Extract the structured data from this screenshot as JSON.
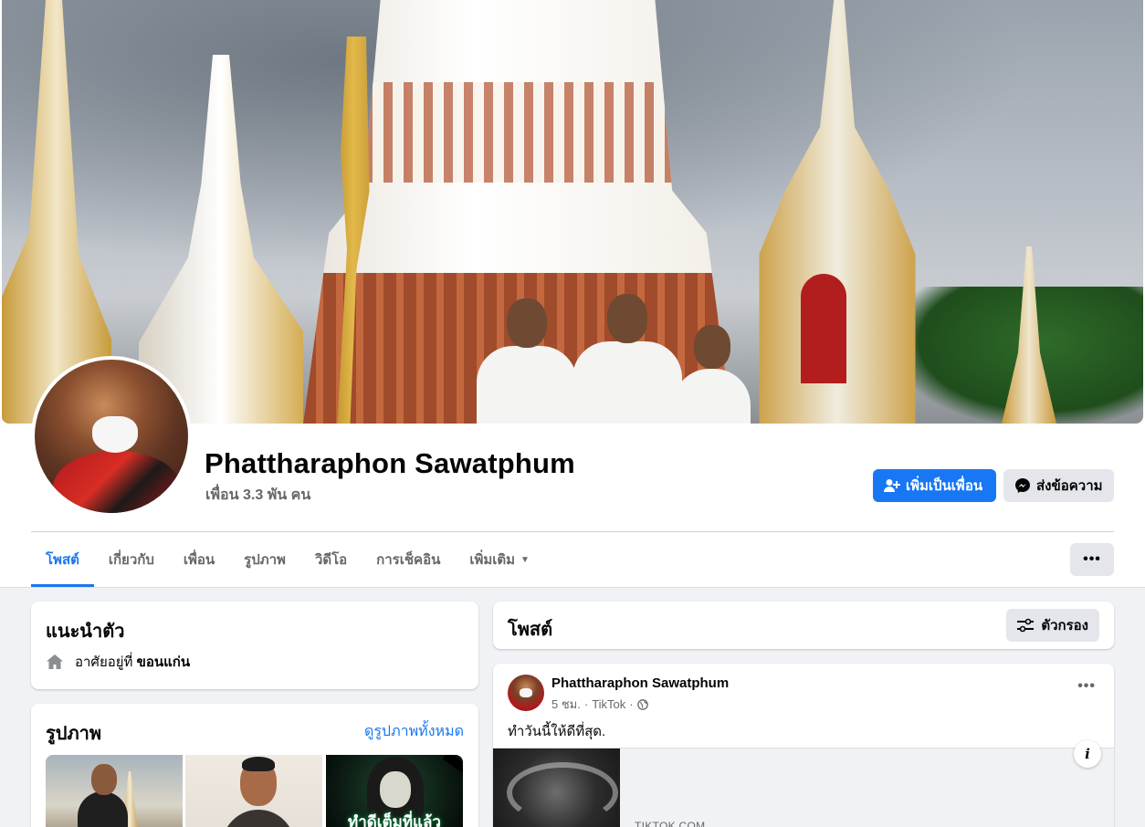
{
  "profile": {
    "name": "Phattharaphon Sawatphum",
    "friends": "เพื่อน 3.3 พัน คน"
  },
  "actions": {
    "add_friend": "เพิ่มเป็นเพื่อน",
    "message": "ส่งข้อความ"
  },
  "tabs": [
    {
      "label": "โพสต์",
      "active": true
    },
    {
      "label": "เกี่ยวกับ"
    },
    {
      "label": "เพื่อน"
    },
    {
      "label": "รูปภาพ"
    },
    {
      "label": "วิดีโอ"
    },
    {
      "label": "การเช็คอิน"
    },
    {
      "label": "เพิ่มเติม"
    }
  ],
  "more_button": "•••",
  "intro": {
    "title": "แนะนำตัว",
    "lives_prefix": "อาศัยอยู่ที่",
    "lives_place": "ขอนแก่น"
  },
  "photos": {
    "title": "รูปภาพ",
    "see_all": "ดูรูปภาพทั้งหมด",
    "caption_3": "ทำดีเต็มที่แล้ว"
  },
  "posts_header": {
    "title": "โพสต์",
    "filter": "ตัวกรอง"
  },
  "post": {
    "author": "Phattharaphon Sawatphum",
    "time": "5 ชม.",
    "source": "TikTok",
    "text": "ทำวันนี้ให้ดีที่สุด.",
    "link_domain": "TIKTOK.COM",
    "menu": "•••",
    "info": "i"
  },
  "colors": {
    "accent": "#1877f2",
    "page_bg": "#f0f2f5",
    "secondary_button": "#e4e6eb",
    "secondary_text": "#65676b"
  }
}
